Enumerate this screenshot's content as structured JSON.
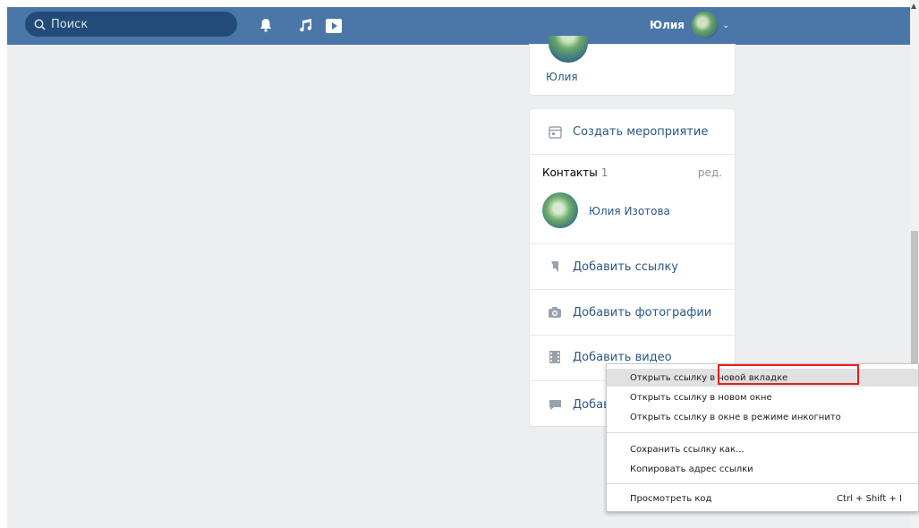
{
  "header": {
    "search_placeholder": "Поиск",
    "user_name": "Юлия",
    "chevron": "⌄",
    "icons": [
      "bell-icon",
      "music-icon",
      "video-icon"
    ],
    "background_color": "#4a76a8"
  },
  "profile_card": {
    "name": "Юлия"
  },
  "sidebar": {
    "create_event": "Создать мероприятие",
    "contacts_title": "Контакты",
    "contacts_count": "1",
    "contacts_edit": "ред.",
    "contact_name": "Юлия Изотова",
    "add_link": "Добавить ссылку",
    "add_photos": "Добавить фотографии",
    "add_video": "Добавить видео",
    "add_other_partial": "Добав"
  },
  "context_menu": {
    "items": [
      "Открыть ссылку в новой вкладке",
      "Открыть ссылку в новом окне",
      "Открыть ссылку в окне в режиме инкогнито",
      "Сохранить ссылку как...",
      "Копировать адрес ссылки",
      "Просмотреть код"
    ],
    "inspect_shortcut": "Ctrl + Shift + I",
    "highlight_color": "#e81f1f"
  }
}
